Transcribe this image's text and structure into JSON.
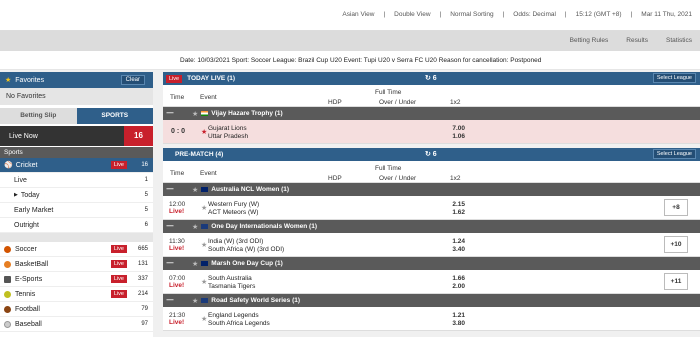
{
  "topbar": {
    "view": "Asian View",
    "double": "Double View",
    "sort": "Normal Sorting",
    "odds": "Odds:  Decimal",
    "time": "15:12  (GMT +8)",
    "date": "Mar 11 Thu, 2021"
  },
  "links": [
    "Betting Rules",
    "Results",
    "Statistics"
  ],
  "notice": "Date: 10/03/2021 Sport: Soccer League: Brazil Cup U20 Event: Tupi U20 v Serra FC U20 Reason for cancellation: Postponed",
  "sidebar": {
    "favorites": "Favorites",
    "clear": "Clear",
    "no_fav": "No Favorites",
    "tab_slip": "Betting Slip",
    "tab_sports": "SPORTS",
    "live_now": "Live Now",
    "live_count": "16",
    "sports_hdr": "Sports",
    "cricket": {
      "label": "Cricket",
      "live": "Live",
      "count": "16"
    },
    "cricket_sub": [
      {
        "label": "Live",
        "count": "1"
      },
      {
        "label": "Today",
        "count": "5"
      },
      {
        "label": "Early Market",
        "count": "5"
      },
      {
        "label": "Outright",
        "count": "6"
      }
    ],
    "sports": [
      {
        "label": "Soccer",
        "live": "Live",
        "count": "665",
        "color": "#d35400"
      },
      {
        "label": "BasketBall",
        "live": "Live",
        "count": "131",
        "color": "#e67e22"
      },
      {
        "label": "E-Sports",
        "live": "Live",
        "count": "337",
        "color": "#555555"
      },
      {
        "label": "Tennis",
        "live": "Live",
        "count": "214",
        "color": "#c0c020"
      },
      {
        "label": "Football",
        "live": "",
        "count": "79",
        "color": "#8b4513"
      },
      {
        "label": "Baseball",
        "live": "",
        "count": "97",
        "color": "#cccccc"
      }
    ]
  },
  "live": {
    "badge": "Live",
    "title": "TODAY LIVE (1)",
    "refresh": "↻ 6",
    "select": "Select League",
    "cols": {
      "time": "Time",
      "event": "Event",
      "ft": "Full Time",
      "hdp": "HDP",
      "ou": "Over / Under",
      "x12": "1x2"
    },
    "league": "Vijay Hazare Trophy (1)",
    "event": {
      "score": "0 : 0",
      "team1": "Gujarat Lions",
      "team2": "Uttar Pradesh",
      "o1": "7.00",
      "o2": "1.06"
    }
  },
  "pre": {
    "title": "PRE-MATCH (4)",
    "refresh": "↻ 6",
    "select": "Select League",
    "cols": {
      "time": "Time",
      "event": "Event",
      "ft": "Full Time",
      "hdp": "HDP",
      "ou": "Over / Under",
      "x12": "1x2"
    },
    "groups": [
      {
        "league": "Australia NCL Women (1)",
        "time": "12:00",
        "live": "Live!",
        "team1": "Western Fury (W)",
        "team2": "ACT Meteors (W)",
        "o1": "2.15",
        "o2": "1.62",
        "more": "+8"
      },
      {
        "league": "One Day Internationals Women (1)",
        "time": "11:30",
        "live": "Live!",
        "team1": "India (W) (3rd ODI)",
        "team2": "South Africa (W) (3rd ODI)",
        "o1": "1.24",
        "o2": "3.40",
        "more": "+10"
      },
      {
        "league": "Marsh One Day Cup (1)",
        "time": "07:00",
        "live": "Live!",
        "team1": "South Australia",
        "team2": "Tasmania Tigers",
        "o1": "1.66",
        "o2": "2.00",
        "more": "+11"
      },
      {
        "league": "Road Safety World Series (1)",
        "time": "21:30",
        "live": "Live!",
        "team1": "England Legends",
        "team2": "South Africa Legends",
        "o1": "1.21",
        "o2": "3.80",
        "more": ""
      }
    ]
  }
}
